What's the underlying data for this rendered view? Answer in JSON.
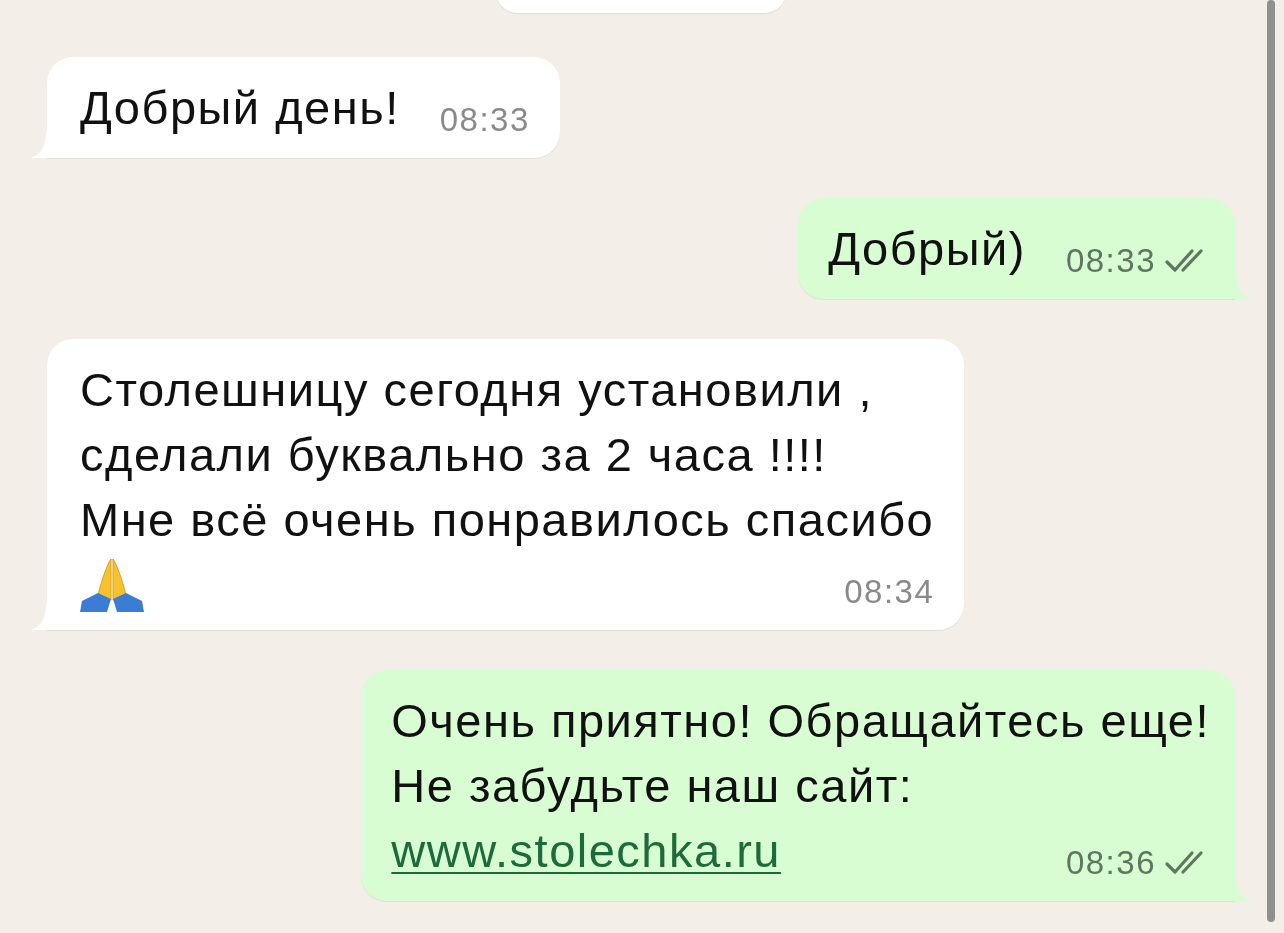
{
  "messages": [
    {
      "outgoing": false,
      "kind": "text",
      "lines": [
        "Добрый день!"
      ],
      "time": "08:33"
    },
    {
      "outgoing": true,
      "kind": "text",
      "lines": [
        "Добрый)"
      ],
      "time": "08:33",
      "delivered": true,
      "read": false
    },
    {
      "outgoing": false,
      "kind": "emoji",
      "lines": [
        "Столешницу сегодня установили ,",
        "сделали буквально за 2 часа !!!!",
        "Мне всё очень понравилось спасибо"
      ],
      "time": "08:34"
    },
    {
      "outgoing": true,
      "kind": "link",
      "lines": [
        "Очень приятно! Обращайтесь еще!",
        "Не забудьте наш сайт:"
      ],
      "link": "www.stolechka.ru",
      "time": "08:36",
      "delivered": true,
      "read": false
    }
  ]
}
